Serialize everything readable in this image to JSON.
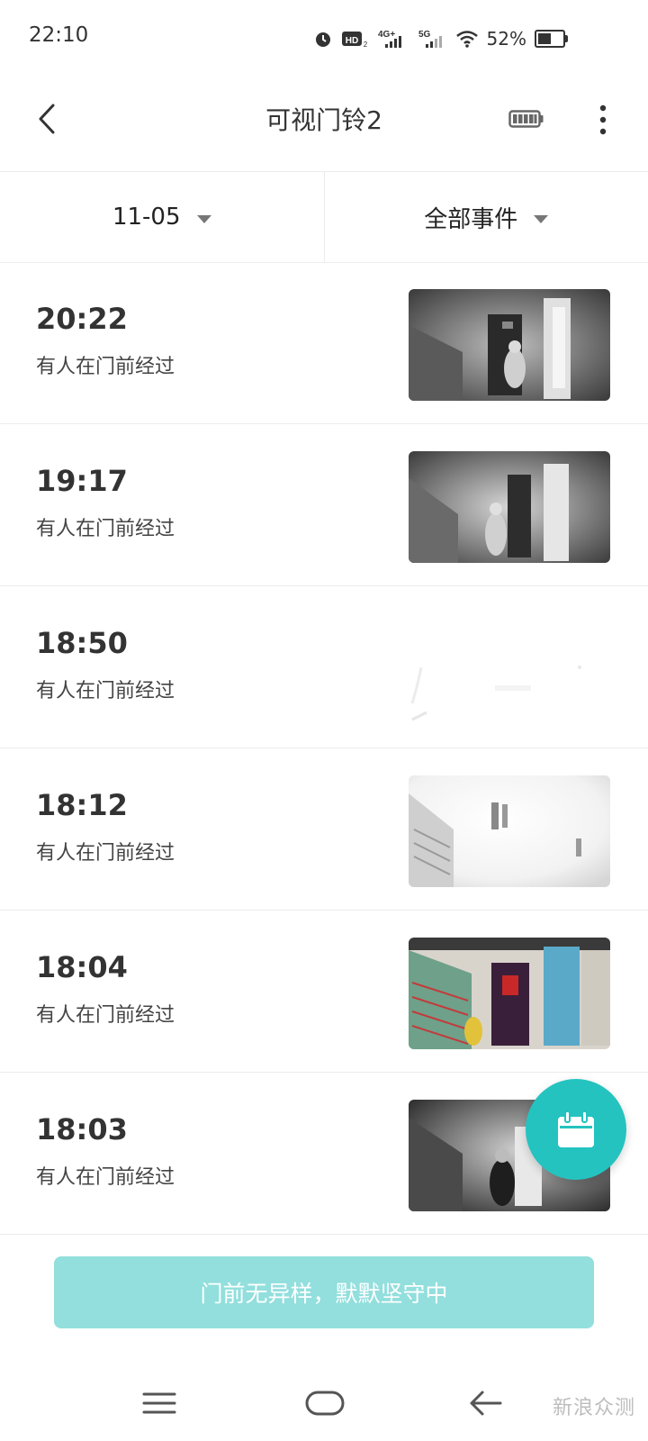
{
  "status_bar": {
    "time": "22:10",
    "battery_percent": "52%",
    "battery_level": 0.52,
    "icons": [
      "alarm-icon",
      "hd-icon",
      "4g-signal-icon",
      "5g-signal-icon",
      "wifi-icon",
      "battery-icon"
    ]
  },
  "header": {
    "title": "可视门铃2",
    "back_icon": "chevron-left-icon",
    "device_battery_icon": "battery-full-icon",
    "more_icon": "more-vertical-icon"
  },
  "filters": {
    "date": "11-05",
    "event_type": "全部事件"
  },
  "events": [
    {
      "time": "20:22",
      "desc": "有人在门前经过",
      "thumb_style": "night-gray"
    },
    {
      "time": "19:17",
      "desc": "有人在门前经过",
      "thumb_style": "night-gray"
    },
    {
      "time": "18:50",
      "desc": "有人在门前经过",
      "thumb_style": "overexposed"
    },
    {
      "time": "18:12",
      "desc": "有人在门前经过",
      "thumb_style": "washed-out"
    },
    {
      "time": "18:04",
      "desc": "有人在门前经过",
      "thumb_style": "color"
    },
    {
      "time": "18:03",
      "desc": "有人在门前经过",
      "thumb_style": "night-gray"
    }
  ],
  "fab": {
    "icon": "calendar-icon",
    "color": "#24c3c0"
  },
  "notice": {
    "text": "门前无异样，默默坚守中",
    "color": "#92dfdd"
  },
  "nav": {
    "icons": [
      "menu-icon",
      "home-icon",
      "back-icon"
    ]
  },
  "watermark": "新浪众测"
}
